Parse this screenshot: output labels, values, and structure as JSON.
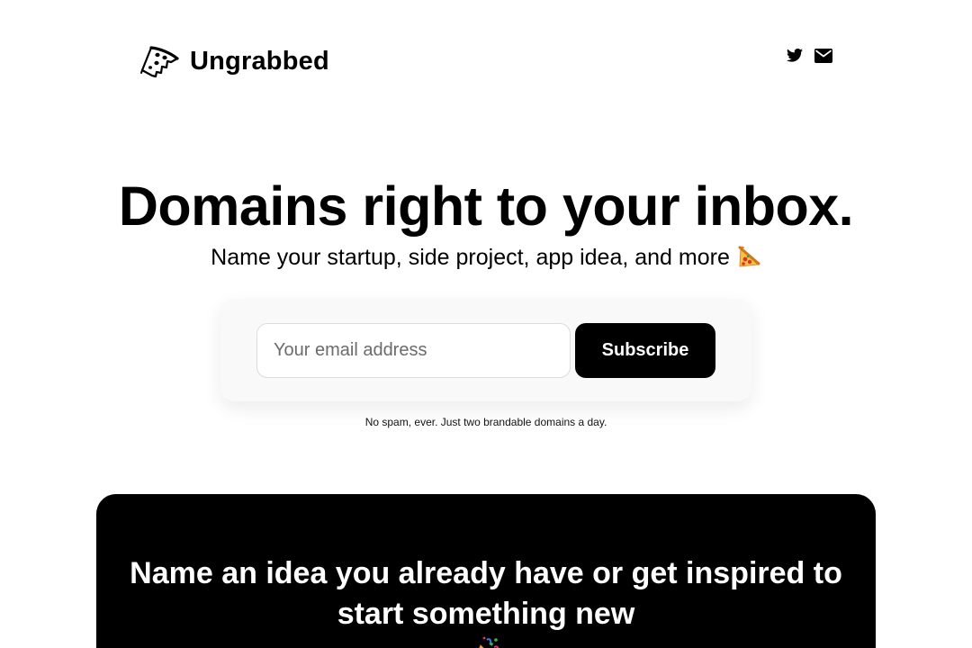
{
  "header": {
    "brand_name": "Ungrabbed",
    "logo_icon": "pizza-slice-icon",
    "social_icons": [
      "twitter-icon",
      "mail-icon"
    ]
  },
  "hero": {
    "title": "Domains right to your inbox.",
    "subtitle": "Name your startup, side project, app idea, and more",
    "subtitle_emoji": "pizza-emoji"
  },
  "signup": {
    "email_value": "",
    "email_placeholder": "Your email address",
    "subscribe_label": "Subscribe",
    "disclaimer": "No spam, ever. Just two brandable domains a day."
  },
  "feature": {
    "title_line1": "Name an idea you already have or get inspired to",
    "title_line2": "start something new",
    "title_emoji": "party-popper-emoji"
  },
  "colors": {
    "background": "#ffffff",
    "text": "#000000",
    "button": "#000000",
    "card": "#f9f9f9",
    "pizza_crust": "#f4a233",
    "pizza_pepperoni": "#d9342b"
  }
}
